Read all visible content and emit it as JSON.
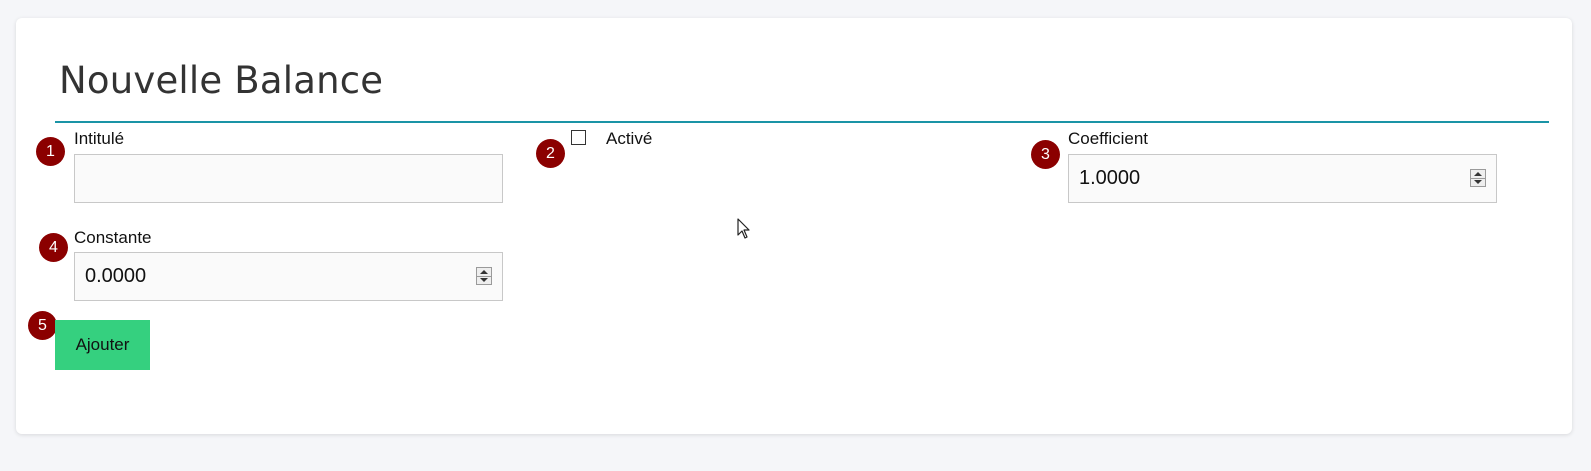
{
  "form": {
    "title": "Nouvelle Balance",
    "accent_color": "#1a94a6",
    "fields": {
      "intitule": {
        "label": "Intitulé",
        "value": ""
      },
      "active": {
        "label": "Activé",
        "checked": false
      },
      "coefficient": {
        "label": "Coefficient",
        "value": "1.0000"
      },
      "constante": {
        "label": "Constante",
        "value": "0.0000"
      }
    },
    "submit_label": "Ajouter",
    "submit_color": "#35d07f"
  },
  "markers": [
    "1",
    "2",
    "3",
    "4",
    "5"
  ],
  "marker_color": "#8b0000",
  "cursor_icon": "mouse-pointer-icon"
}
